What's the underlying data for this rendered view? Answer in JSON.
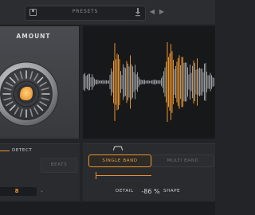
{
  "header": {
    "preset_label": "PRESETS",
    "prev_icon": "chevron-left-icon",
    "next_icon": "chevron-right-icon"
  },
  "amount": {
    "title": "AMOUNT",
    "knob_level": 0.62
  },
  "detect": {
    "label": "DETECT",
    "beats_label": "BEATS",
    "value": "8"
  },
  "band": {
    "single_label": "SINGLE BAND",
    "multi_label": "MULTI BAND",
    "detail_label": "DETAIL",
    "detail_value": "-86 %",
    "shape_label": "SHAPE"
  },
  "colors": {
    "accent": "#e7932f",
    "background": "#232427",
    "waveform": "#e7932f"
  }
}
